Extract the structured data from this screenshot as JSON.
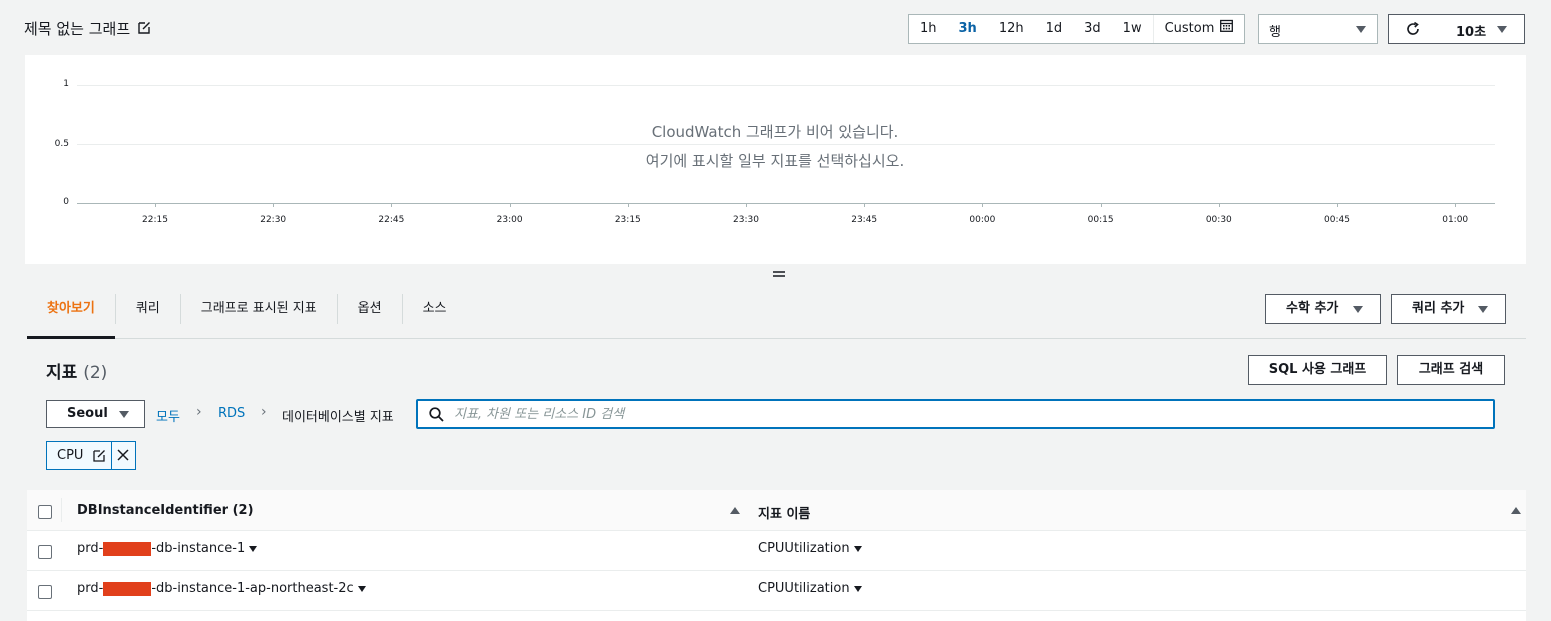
{
  "header": {
    "title": "제목 없는 그래프",
    "time_ranges": [
      "1h",
      "3h",
      "12h",
      "1d",
      "3d",
      "1w"
    ],
    "active_range": "3h",
    "custom_label": "Custom",
    "view_select": "행",
    "refresh_interval": "10초"
  },
  "graph": {
    "empty_line1": "CloudWatch 그래프가 비어 있습니다.",
    "empty_line2": "여기에 표시할 일부 지표를 선택하십시오.",
    "y_ticks": [
      "1",
      "0.5",
      "0"
    ],
    "x_ticks": [
      "22:15",
      "22:30",
      "22:45",
      "23:00",
      "23:15",
      "23:30",
      "23:45",
      "00:00",
      "00:15",
      "00:30",
      "00:45",
      "01:00"
    ]
  },
  "tabs": {
    "items": [
      "찾아보기",
      "쿼리",
      "그래프로 표시된 지표",
      "옵션",
      "소스"
    ],
    "active": "찾아보기",
    "math_button": "수학 추가",
    "query_button": "쿼리 추가"
  },
  "metrics": {
    "title": "지표",
    "count": "(2)",
    "sql_button": "SQL 사용 그래프",
    "search_graph_button": "그래프 검색",
    "region": "Seoul",
    "breadcrumb": [
      "모두",
      "RDS",
      "데이터베이스별 지표"
    ],
    "search_placeholder": "지표, 차원 또는 리소스 ID 검색",
    "chip_label": "CPU"
  },
  "table": {
    "columns": [
      "DBInstanceIdentifier",
      "(2)",
      "지표 이름"
    ],
    "rows": [
      {
        "id_prefix": "prd-",
        "id_suffix": "-db-instance-1",
        "metric": "CPUUtilization"
      },
      {
        "id_prefix": "prd-",
        "id_suffix": "-db-instance-1-ap-northeast-2c",
        "metric": "CPUUtilization"
      }
    ]
  }
}
